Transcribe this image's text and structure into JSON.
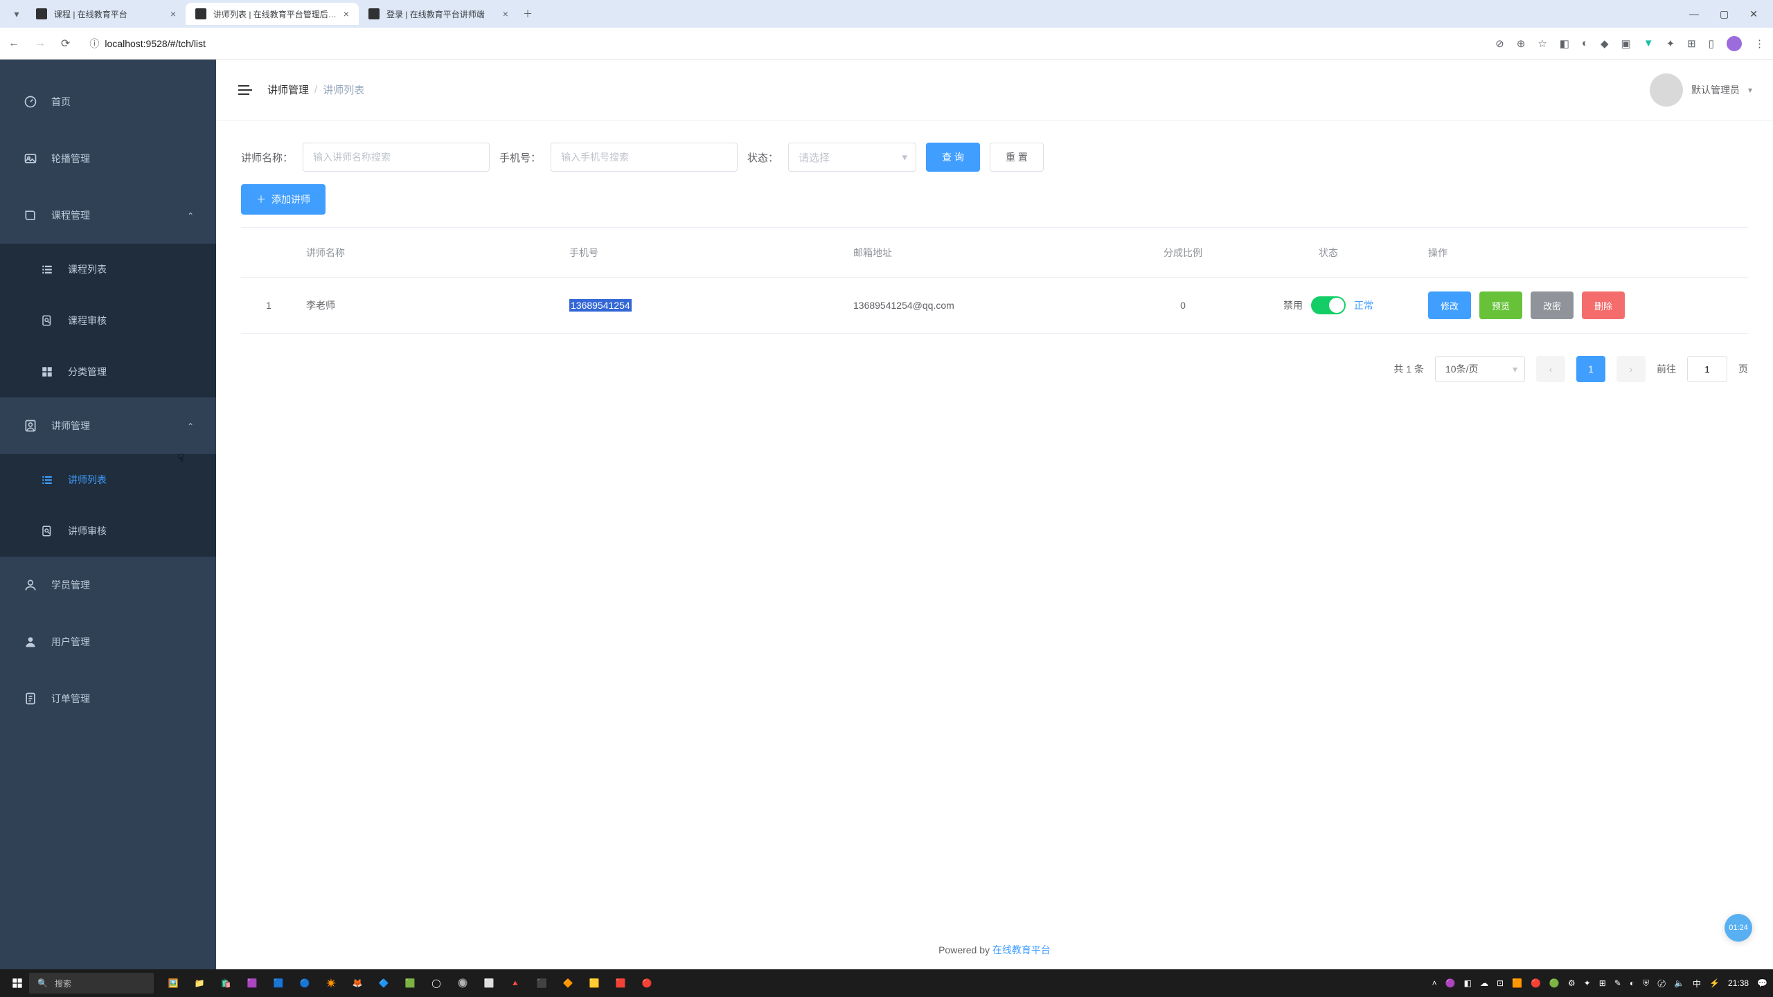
{
  "browser": {
    "tabs": [
      {
        "title": "课程 | 在线教育平台"
      },
      {
        "title": "讲师列表 | 在线教育平台管理后…"
      },
      {
        "title": "登录 | 在线教育平台讲师端"
      }
    ],
    "url": "localhost:9528/#/tch/list"
  },
  "sidebar": {
    "home": "首页",
    "carousel": "轮播管理",
    "course_mgmt": "课程管理",
    "course_list": "课程列表",
    "course_audit": "课程审核",
    "category_mgmt": "分类管理",
    "teacher_mgmt": "讲师管理",
    "teacher_list": "讲师列表",
    "teacher_audit": "讲师审核",
    "student_mgmt": "学员管理",
    "user_mgmt": "用户管理",
    "order_mgmt": "订单管理"
  },
  "header": {
    "bc1": "讲师管理",
    "bc2": "讲师列表",
    "user": "默认管理员"
  },
  "search": {
    "name_label": "讲师名称：",
    "name_placeholder": "输入讲师名称搜索",
    "phone_label": "手机号：",
    "phone_placeholder": "输入手机号搜索",
    "status_label": "状态：",
    "status_placeholder": "请选择",
    "query": "查 询",
    "reset": "重 置",
    "add": "添加讲师"
  },
  "table": {
    "headers": {
      "name": "讲师名称",
      "phone": "手机号",
      "email": "邮箱地址",
      "ratio": "分成比例",
      "status": "状态",
      "ops": "操作"
    },
    "status_labels": {
      "disabled": "禁用",
      "enabled": "正常"
    },
    "op_labels": {
      "edit": "修改",
      "preview": "预览",
      "pwd": "改密",
      "delete": "删除"
    },
    "rows": [
      {
        "idx": "1",
        "name": "李老师",
        "phone": "13689541254",
        "email": "13689541254@qq.com",
        "ratio": "0",
        "enabled": true
      }
    ]
  },
  "pagination": {
    "total": "共 1 条",
    "page_size": "10条/页",
    "current": "1",
    "goto_label_prefix": "前往",
    "goto_value": "1",
    "goto_label_suffix": "页"
  },
  "footer": {
    "powered": "Powered by ",
    "link": "在线教育平台"
  },
  "badge": "01:24",
  "taskbar": {
    "search": "搜索",
    "time": "21:38"
  }
}
